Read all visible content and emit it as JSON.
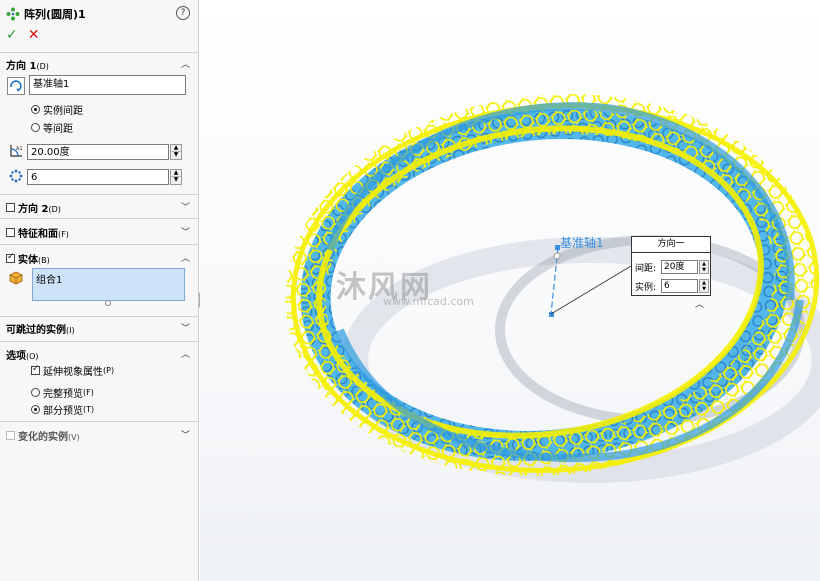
{
  "feature": {
    "title": "阵列(圆周)1",
    "help_glyph": "?",
    "ok_glyph": "✓",
    "cancel_glyph": "✕"
  },
  "direction1": {
    "heading": "方向 1",
    "shortcut": "(D)",
    "axis_value": "基准轴1",
    "radio_instance_spacing": "实例间距",
    "radio_equal_spacing": "等间距",
    "radio_selected": "实例间距",
    "angle_value": "20.00度",
    "count_value": "6"
  },
  "direction2": {
    "heading": "方向 2",
    "shortcut": "(D)",
    "checked": false
  },
  "features_faces": {
    "heading": "特征和面",
    "shortcut": "(F)",
    "checked": false
  },
  "bodies": {
    "heading": "实体",
    "shortcut": "(B)",
    "checked": true,
    "item": "组合1"
  },
  "skip_instances": {
    "heading": "可跳过的实例",
    "shortcut": "(I)"
  },
  "options": {
    "heading": "选项",
    "shortcut": "(O)",
    "propagate_label": "延伸视象属性",
    "propagate_shortcut": "(P)",
    "propagate_checked": true,
    "full_preview": "完整预览",
    "full_preview_shortcut": "(F)",
    "partial_preview": "部分预览",
    "partial_preview_shortcut": "(T)",
    "preview_selected": "部分预览"
  },
  "varied_instances": {
    "heading": "变化的实例",
    "shortcut": "(V)",
    "checked": false
  },
  "viewport": {
    "axis_label": "基准轴1",
    "callout_title": "方向一",
    "callout_spacing_label": "间距:",
    "callout_spacing_value": "20度",
    "callout_count_label": "实例:",
    "callout_count_value": "6",
    "watermark_cn": "沐风网",
    "watermark_url": "www.mfcad.com"
  },
  "colors": {
    "ring_yellow": "#f5f000",
    "ring_blue": "#2f9be0",
    "accent_blue": "#3a8fe0",
    "ok_green": "#2e9b2e",
    "cancel_red": "#dd1111"
  }
}
